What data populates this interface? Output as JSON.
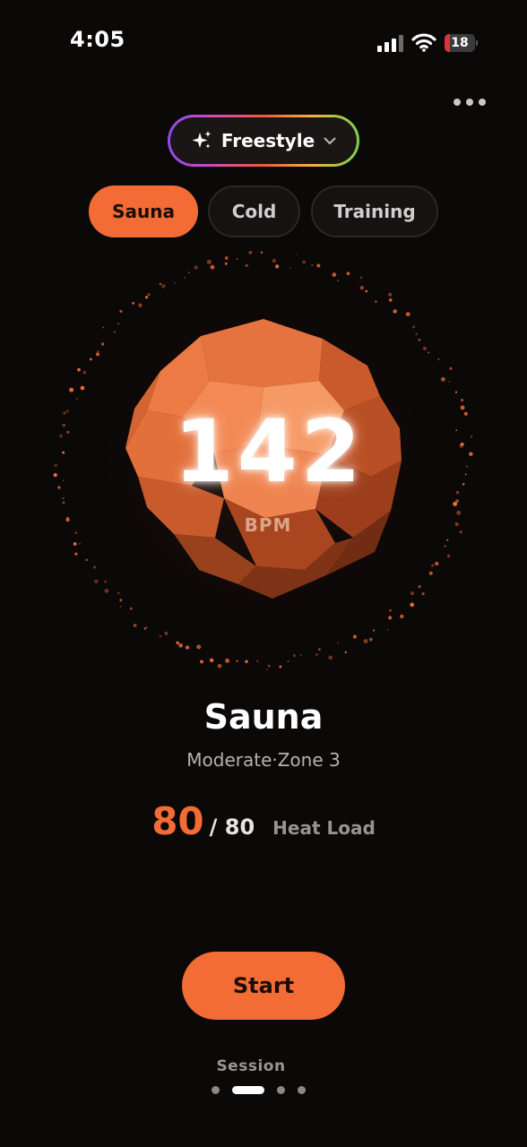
{
  "status_bar": {
    "time": "4:05",
    "battery_level": "18",
    "battery_fraction": 0.18
  },
  "mode_selector": {
    "label": "Freestyle",
    "icon": "sparkles-icon"
  },
  "tabs": [
    {
      "label": "Sauna",
      "active": true
    },
    {
      "label": "Cold",
      "active": false
    },
    {
      "label": "Training",
      "active": false
    }
  ],
  "heart_rate": {
    "value": "142",
    "unit": "BPM"
  },
  "session": {
    "title": "Sauna",
    "intensity": "Moderate",
    "separator": "·",
    "zone": "Zone 3",
    "heat_load_value": "80",
    "heat_load_max": "/ 80",
    "heat_load_label": "Heat Load",
    "start_label": "Start",
    "page_label": "Session"
  },
  "pager": {
    "count": 4,
    "active_index": 1
  },
  "colors": {
    "accent": "#f36b35",
    "background": "#0b0808",
    "orb_light": "#f7985f",
    "orb_dark": "#7a2f14"
  }
}
